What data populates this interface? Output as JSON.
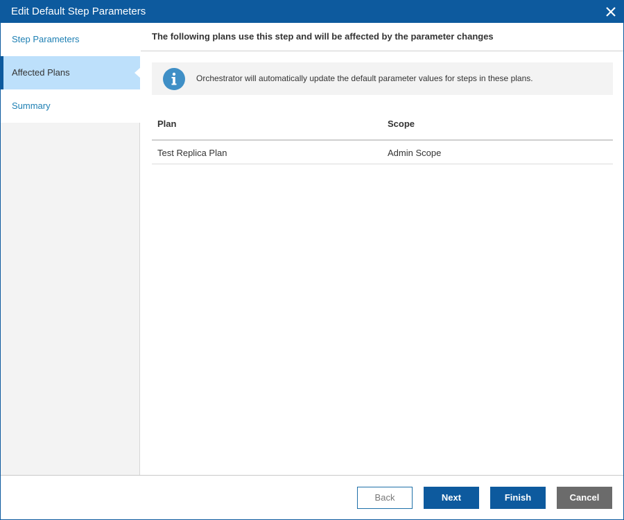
{
  "window": {
    "title": "Edit Default Step Parameters",
    "close_icon": "close-icon"
  },
  "sidebar": {
    "items": [
      {
        "label": "Step Parameters",
        "active": false
      },
      {
        "label": "Affected Plans",
        "active": true
      },
      {
        "label": "Summary",
        "active": false
      }
    ]
  },
  "main": {
    "header": "The following plans use this step and will be affected by the parameter changes",
    "info": {
      "icon": "info-icon",
      "text": "Orchestrator will automatically update the default parameter values for steps in these plans."
    },
    "table": {
      "columns": [
        "Plan",
        "Scope"
      ],
      "rows": [
        {
          "plan": "Test Replica Plan",
          "scope": "Admin Scope"
        }
      ]
    }
  },
  "footer": {
    "back_label": "Back",
    "next_label": "Next",
    "finish_label": "Finish",
    "cancel_label": "Cancel"
  },
  "colors": {
    "titlebar": "#0d5a9e",
    "active_nav": "#bde0fb",
    "link": "#1d7fb3",
    "primary_button": "#0d5a9e",
    "cancel_button": "#6b6b6b",
    "info_icon": "#3f8fc6"
  }
}
